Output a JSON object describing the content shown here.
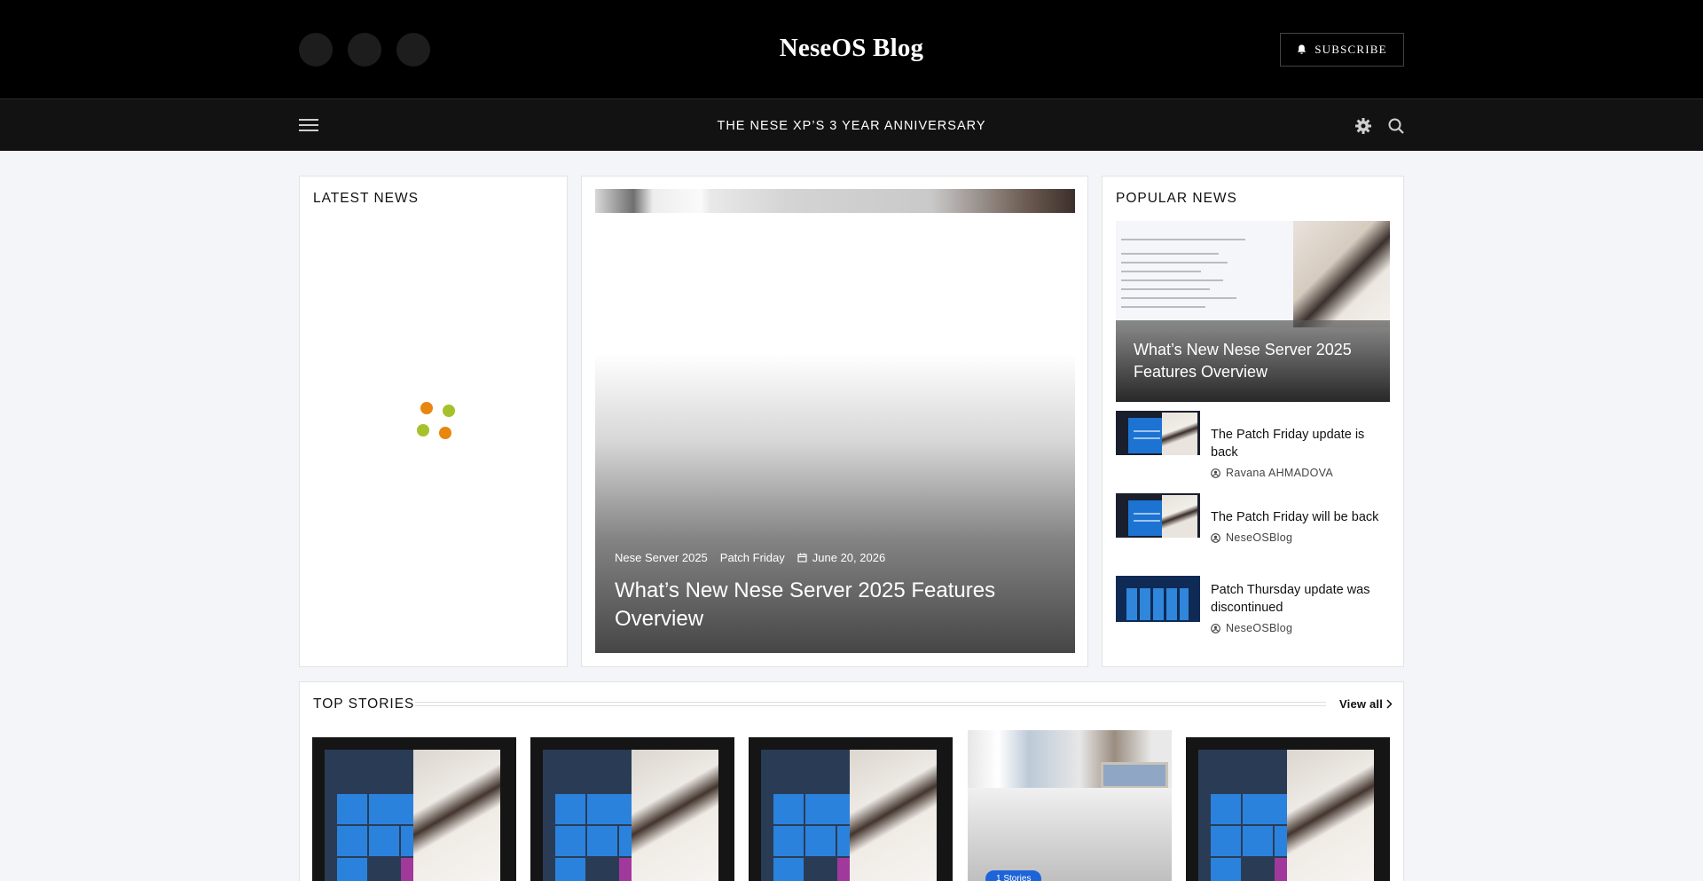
{
  "header": {
    "site_title": "NeseOS Blog",
    "subscribe_label": "SUBSCRIBE",
    "social_icons": [
      "social-icon-1",
      "social-icon-2",
      "social-icon-3"
    ]
  },
  "nav": {
    "ticker": "THE NESE XP’S 3 YEAR ANNIVERSARY",
    "icons": [
      "menu-icon",
      "theme-toggle-icon",
      "search-icon"
    ]
  },
  "latest_news": {
    "title": "LATEST NEWS",
    "loader_colors": [
      "#e8860e",
      "#a5c12c"
    ]
  },
  "featured": {
    "category_1": "Nese Server 2025",
    "category_2": "Patch Friday",
    "date": "June 20, 2026",
    "title": "What’s New Nese Server 2025 Features Overview"
  },
  "popular_news": {
    "title": "POPULAR NEWS",
    "feature_title": "What’s New Nese Server 2025 Features Overview",
    "items": [
      {
        "title": "The Patch Friday update is back",
        "author": "Ravana AHMADOVA"
      },
      {
        "title": "The Patch Friday will be back",
        "author": "NeseOSBlog"
      },
      {
        "title": "Patch Thursday update was discontinued",
        "author": "NeseOSBlog"
      }
    ]
  },
  "top_stories": {
    "title": "TOP STORIES",
    "view_all_label": "View all",
    "badge_label": "1 Stories"
  }
}
